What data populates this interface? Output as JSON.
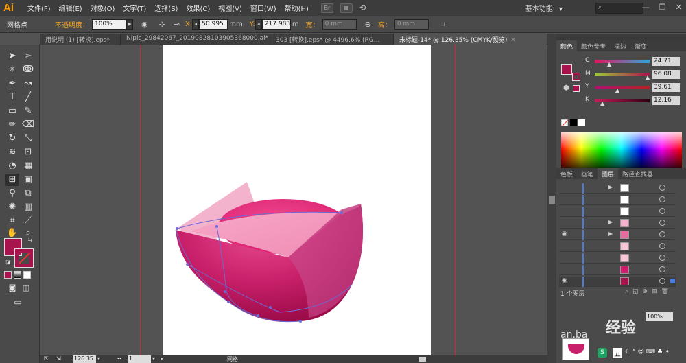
{
  "app": {
    "logo": "Ai"
  },
  "menu": [
    "文件(F)",
    "编辑(E)",
    "对象(O)",
    "文字(T)",
    "选择(S)",
    "效果(C)",
    "视图(V)",
    "窗口(W)",
    "帮助(H)"
  ],
  "menu_icons": {
    "br": "Br",
    "arrange": "arrange-icon",
    "sync": "sync-icon"
  },
  "workspace": {
    "label": "基本功能",
    "arrow": "▾"
  },
  "window_controls": {
    "minimize": "—",
    "restore": "❐",
    "close": "✕"
  },
  "control_bar": {
    "mode_label": "网格点",
    "opacity_label": "不透明度：",
    "opacity_value": "100%",
    "x_label": "X:",
    "x_value": "50.995",
    "x_unit": "mm",
    "y_label": "Y:",
    "y_value": "217.983",
    "y_unit": "m",
    "w_label": "宽：",
    "w_value": "0 mm",
    "h_label": "高：",
    "h_value": "0 mm"
  },
  "tabs": [
    {
      "label": "用说明 (1) [转换].eps*",
      "active": false
    },
    {
      "label": "Nipic_29842067_20190828103905368000.ai*",
      "active": false
    },
    {
      "label": "303 [转换].eps* @ 4496.6% (RG...",
      "active": false
    },
    {
      "label": "未标题-14* @ 126.35% (CMYK/预览)",
      "active": true
    }
  ],
  "status_bar": {
    "zoom": "126.35",
    "page": "1",
    "tool": "网格"
  },
  "color_panel": {
    "tabs": [
      "颜色",
      "颜色参考",
      "描边",
      "渐变"
    ],
    "channels": [
      {
        "label": "C",
        "value": "24.71",
        "gradient": "linear-gradient(to right,#e8135e,#2ba8d9)"
      },
      {
        "label": "M",
        "value": "96.08",
        "gradient": "linear-gradient(to right,#9ec93a,#a8124d)"
      },
      {
        "label": "Y",
        "value": "39.61",
        "gradient": "linear-gradient(to right,#b0126a,#b61f2a)"
      },
      {
        "label": "K",
        "value": "12.16",
        "gradient": "linear-gradient(to right,#c91a5a,#2a0010)"
      }
    ],
    "fill_color": "#a8124d"
  },
  "layers_panel": {
    "tabs": [
      "色板",
      "画笔",
      "图层",
      "路径查找器"
    ],
    "footer": "1 个图层"
  },
  "watermark": {
    "text": "经验",
    "sub": "an.ba"
  },
  "taskbar_badge": "五"
}
